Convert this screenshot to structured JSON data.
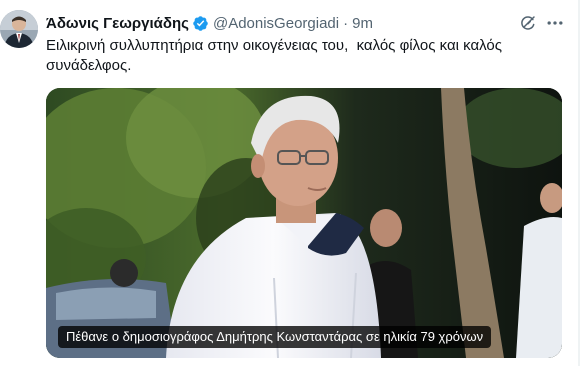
{
  "tweet": {
    "author_name": "Άδωνις Γεωργιάδης",
    "handle": "@AdonisGeorgiadi",
    "separator": "·",
    "time": "9m",
    "text": "Ειλικρινή συλλυπητήρια στην οικογένειας του,  καλός φίλος και καλός συνάδελφος.",
    "media": {
      "caption": "Πέθανε ο δημοσιογράφος Δημήτρης Κωνσταντάρας σε ηλικία 79 χρόνων"
    }
  },
  "icons": {
    "verified": "verified-badge-icon",
    "grok": "grok-icon",
    "more": "more-options-icon"
  },
  "colors": {
    "verified": "#1d9bf0",
    "secondary_text": "#536471",
    "primary_text": "#0f1419"
  }
}
